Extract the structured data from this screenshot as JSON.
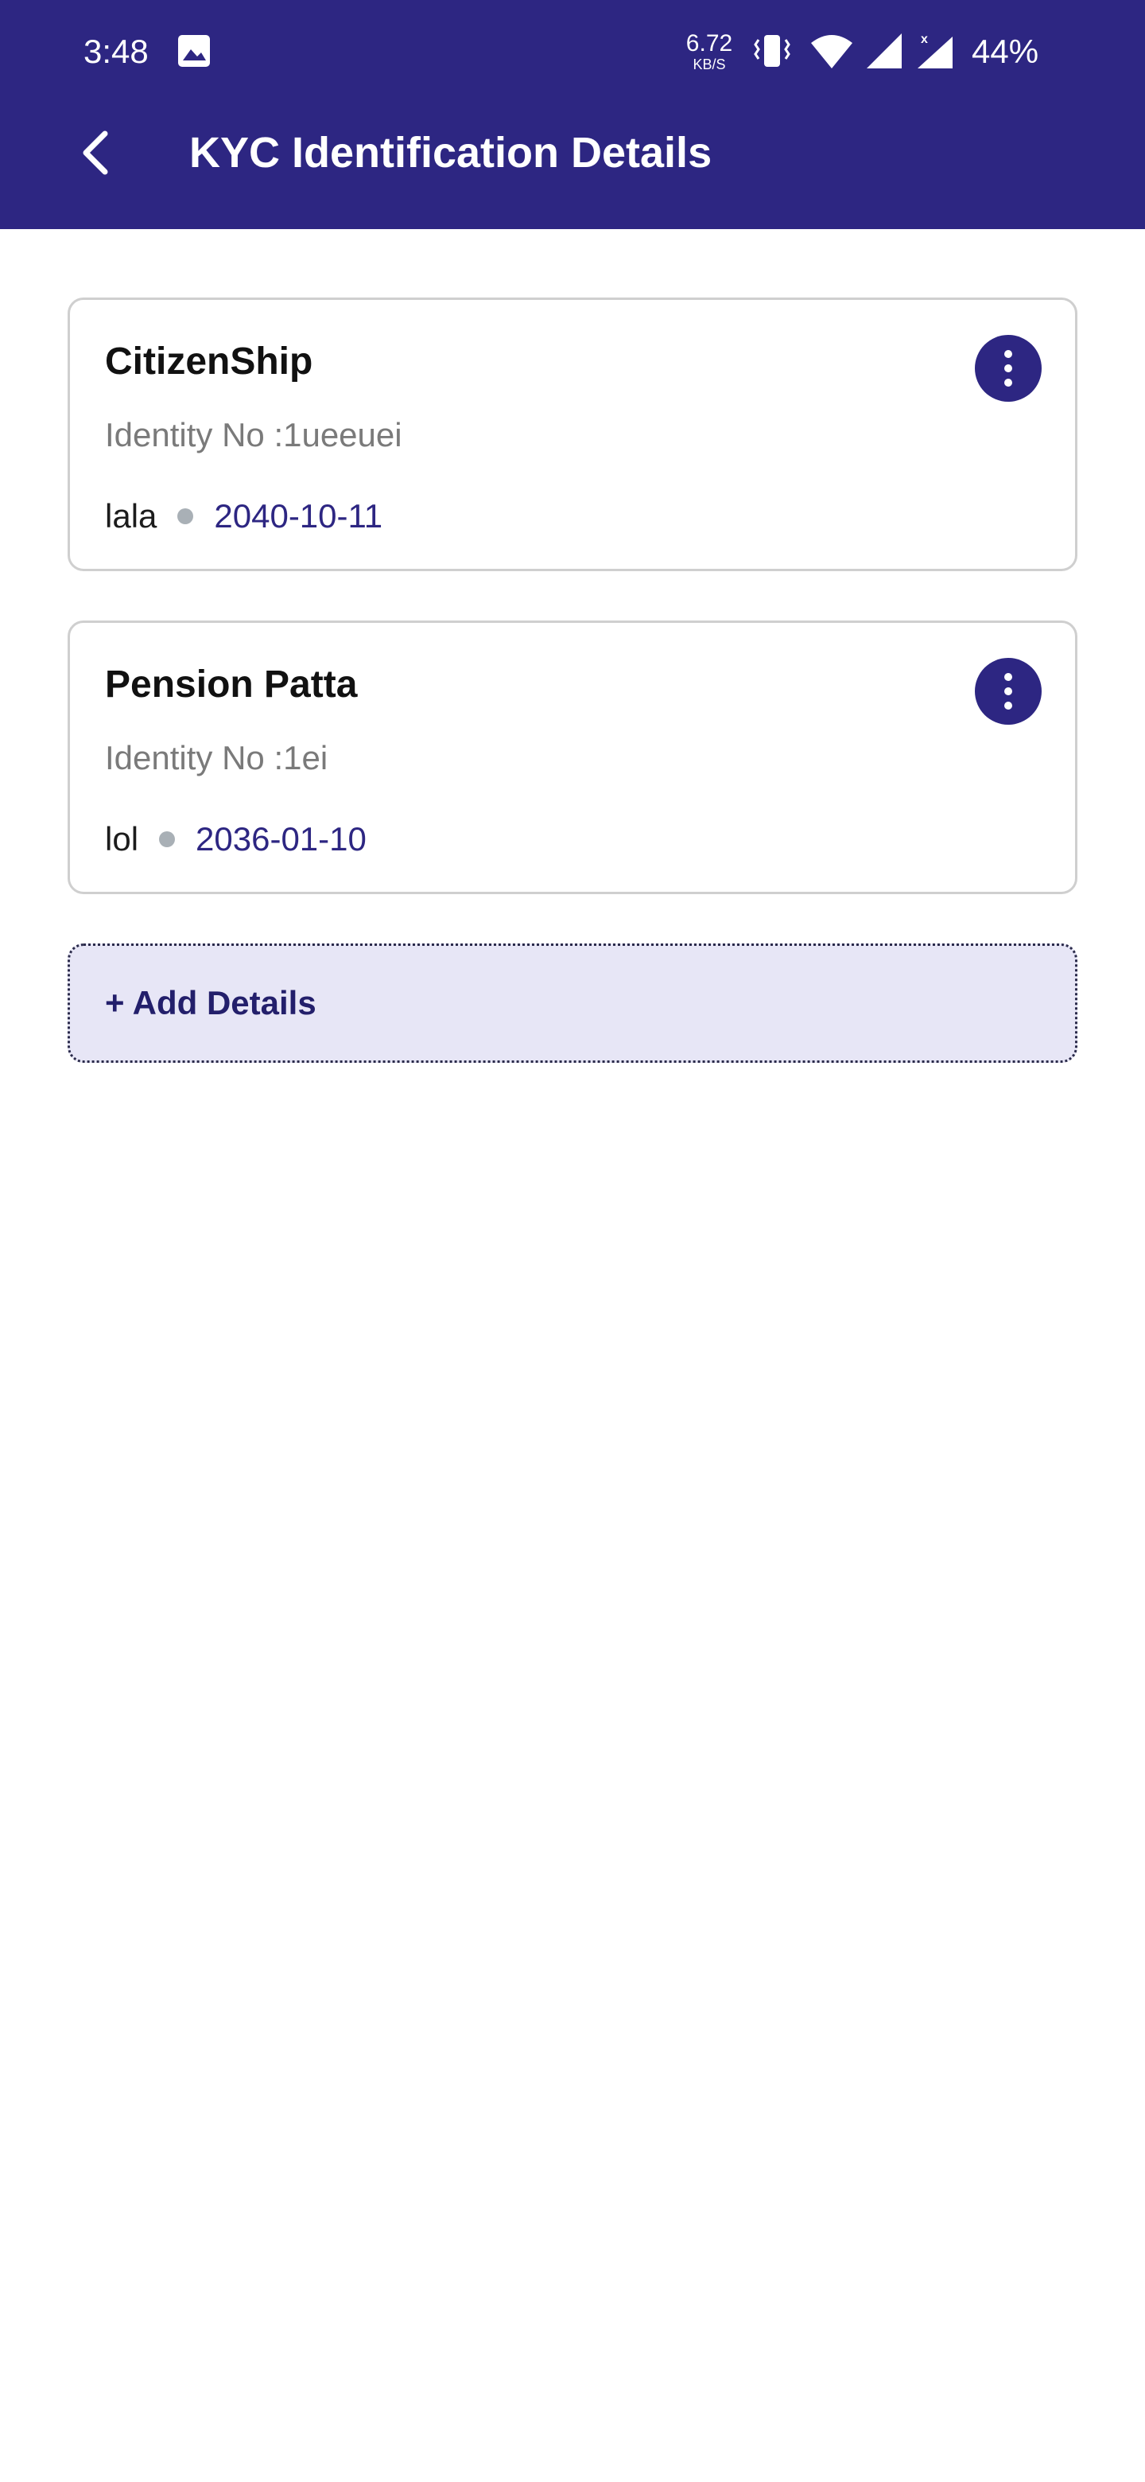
{
  "status_bar": {
    "time": "3:48",
    "net_speed": "6.72",
    "net_unit": "KB/S",
    "battery": "44%",
    "icons": [
      "gallery-icon",
      "vibrate-icon",
      "wifi-icon",
      "signal-icon",
      "signal-no-data-icon"
    ]
  },
  "app_bar": {
    "title": "KYC Identification Details",
    "back_icon": "chevron-left-icon"
  },
  "cards": [
    {
      "title": "CitizenShip",
      "identity": "Identity No :1ueeuei",
      "name": "lala",
      "date": "2040-10-11"
    },
    {
      "title": "Pension Patta",
      "identity": "Identity No :1ei",
      "name": "lol",
      "date": "2036-01-10"
    }
  ],
  "add_button": {
    "label": "+ Add Details"
  },
  "colors": {
    "primary": "#2d2682",
    "add_bg": "#e7e6f6",
    "muted_text": "#7a7a7a",
    "dot": "#a9b0b6"
  }
}
